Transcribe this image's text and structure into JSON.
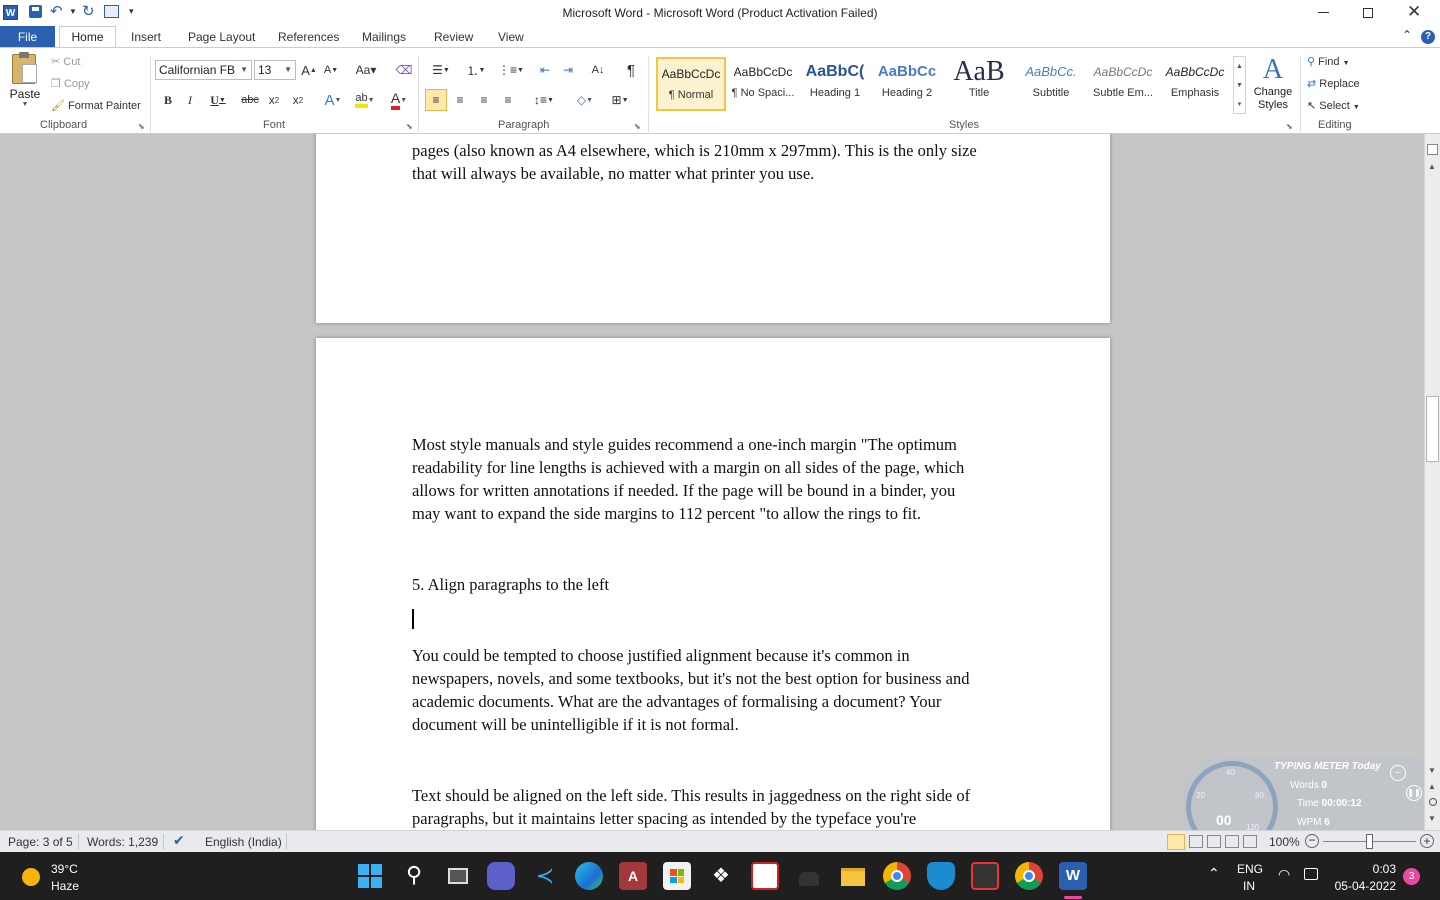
{
  "window": {
    "title": "Microsoft Word  -  Microsoft Word (Product Activation Failed)"
  },
  "tabs": [
    {
      "label": "File"
    },
    {
      "label": "Home"
    },
    {
      "label": "Insert"
    },
    {
      "label": "Page Layout"
    },
    {
      "label": "References"
    },
    {
      "label": "Mailings"
    },
    {
      "label": "Review"
    },
    {
      "label": "View"
    }
  ],
  "clipboard": {
    "paste": "Paste",
    "cut": "Cut",
    "copy": "Copy",
    "format_painter": "Format Painter",
    "group": "Clipboard"
  },
  "font": {
    "name": "Californian FB",
    "size": "13",
    "group": "Font"
  },
  "paragraph": {
    "group": "Paragraph"
  },
  "styles": {
    "group": "Styles",
    "items": [
      {
        "preview": "AaBbCcDc",
        "name": "¶ Normal"
      },
      {
        "preview": "AaBbCcDc",
        "name": "¶ No Spaci..."
      },
      {
        "preview": "AaBbC(",
        "name": "Heading 1"
      },
      {
        "preview": "AaBbCc",
        "name": "Heading 2"
      },
      {
        "preview": "AaB",
        "name": "Title"
      },
      {
        "preview": "AaBbCc.",
        "name": "Subtitle"
      },
      {
        "preview": "AaBbCcDc",
        "name": "Subtle Em..."
      },
      {
        "preview": "AaBbCcDc",
        "name": "Emphasis"
      }
    ],
    "change_styles": "Change Styles"
  },
  "editing": {
    "find": "Find",
    "replace": "Replace",
    "select": "Select",
    "group": "Editing"
  },
  "document": {
    "page1": {
      "line1": "pages (also known  as A4 elsewhere,  which is 210mm x 297mm). This is the only size",
      "line2": "that will always be available, no matter what printer you use."
    },
    "page2": {
      "p1": [
        "Most style manuals and style guides recommend  a one-inch margin \"The optimum",
        "readability for line lengths is achieved with a margin on all sides of the page, which",
        "allows for written annotations if needed.  If the page will be bound in a binder, you",
        "may want to expand the side margins to 112 percent  \"to allow the rings to fit."
      ],
      "heading": "5. Align paragraphs to the left",
      "p2": [
        "You could be tempted  to choose justified alignment because it's common in",
        "newspapers, novels, and some textbooks, but it's not the best option for business and",
        "academic documents. What are the advantages of formalising a document? Your",
        "document  will be unintelligible if it is not formal."
      ],
      "p3": [
        "Text should be aligned on the left side. This results in jaggedness on the right side of",
        "paragraphs, but it maintains letter spacing as intended by the typeface you're"
      ]
    }
  },
  "statusbar": {
    "page": "Page: 3 of 5",
    "words": "Words: 1,239",
    "language": "English (India)",
    "zoom": "100%"
  },
  "typing_meter": {
    "title": "TYPING METER Today",
    "words_label": "Words",
    "words": "0",
    "time_label": "Time",
    "time": "00:00:12",
    "wpm_label": "WPM",
    "wpm": "6",
    "gauge": "00",
    "ticks": [
      "40",
      "20",
      "80",
      "120"
    ]
  },
  "taskbar": {
    "weather_temp": "39°C",
    "weather_desc": "Haze",
    "lang_top": "ENG",
    "lang_bottom": "IN",
    "time": "0:03",
    "date": "05-04-2022",
    "badge": "3"
  },
  "colors": {
    "accent": "#2b5fb0",
    "taskbar": "#1f1f1f",
    "selected_style": "#f5c542"
  }
}
